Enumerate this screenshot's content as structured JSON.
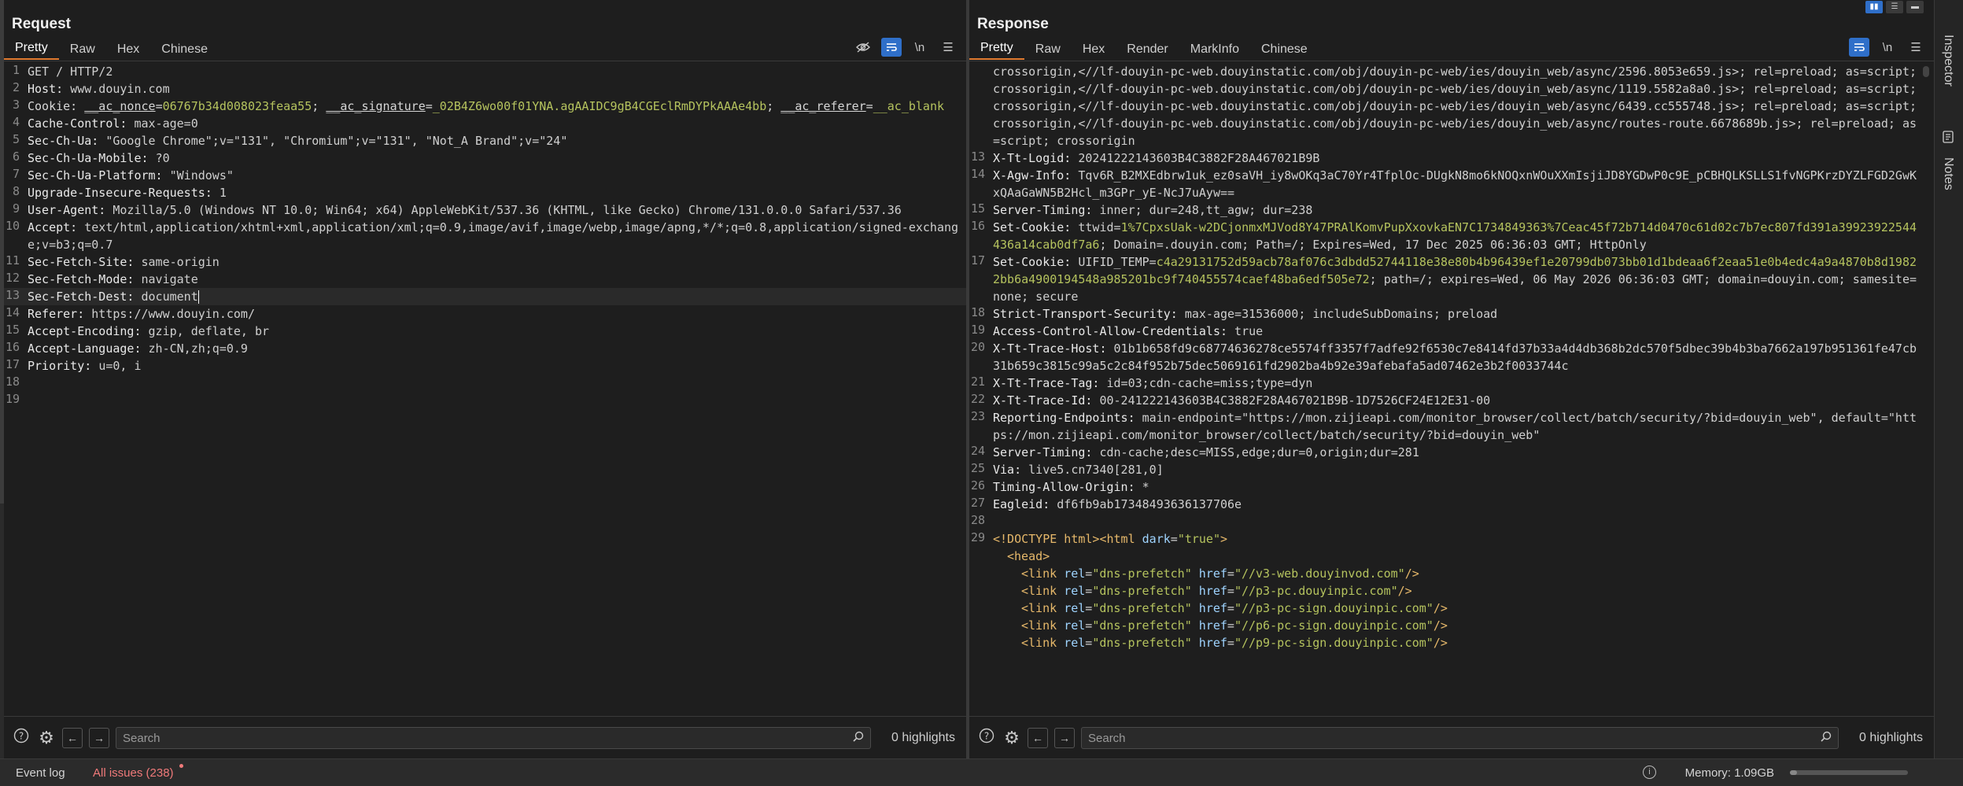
{
  "request": {
    "title": "Request",
    "tabs": [
      "Pretty",
      "Raw",
      "Hex",
      "Chinese"
    ],
    "active_tab": "Pretty",
    "lines": [
      {
        "n": "1",
        "plain": "GET / HTTP/2"
      },
      {
        "n": "2",
        "k": "Host: ",
        "v": "www.douyin.com"
      },
      {
        "n": "3",
        "cookie": [
          {
            "t": "Cookie: ",
            "c": "ck"
          },
          {
            "t": "__ac_nonce",
            "c": "cu"
          },
          {
            "t": "=",
            "c": "ck"
          },
          {
            "t": "06767b34d008023feaa55",
            "c": "cv"
          },
          {
            "t": "; ",
            "c": "ck"
          },
          {
            "t": "__ac_signature",
            "c": "cu"
          },
          {
            "t": "=",
            "c": "ck"
          },
          {
            "t": "_02B4Z6wo00f01YNA.agAAIDC9gB4CGEclRmDYPkAAAe4bb",
            "c": "cv"
          },
          {
            "t": "; ",
            "c": "ck"
          },
          {
            "t": "__ac_referer",
            "c": "cu"
          },
          {
            "t": "=",
            "c": "ck"
          },
          {
            "t": "__ac_blank",
            "c": "cv"
          }
        ]
      },
      {
        "n": "4",
        "k": "Cache-Control: ",
        "v": "max-age=0"
      },
      {
        "n": "5",
        "k": "Sec-Ch-Ua: ",
        "v": "\"Google Chrome\";v=\"131\", \"Chromium\";v=\"131\", \"Not_A Brand\";v=\"24\""
      },
      {
        "n": "6",
        "k": "Sec-Ch-Ua-Mobile: ",
        "v": "?0"
      },
      {
        "n": "7",
        "k": "Sec-Ch-Ua-Platform: ",
        "v": "\"Windows\""
      },
      {
        "n": "8",
        "k": "Upgrade-Insecure-Requests: ",
        "v": "1"
      },
      {
        "n": "9",
        "k": "User-Agent: ",
        "v": "Mozilla/5.0 (Windows NT 10.0; Win64; x64) AppleWebKit/537.36 (KHTML, like Gecko) Chrome/131.0.0.0 Safari/537.36"
      },
      {
        "n": "10",
        "k": "Accept: ",
        "v": "text/html,application/xhtml+xml,application/xml;q=0.9,image/avif,image/webp,image/apng,*/*;q=0.8,application/signed-exchange;v=b3;q=0.7",
        "wrap": true
      },
      {
        "n": "11",
        "k": "Sec-Fetch-Site: ",
        "v": "same-origin"
      },
      {
        "n": "12",
        "k": "Sec-Fetch-Mode: ",
        "v": "navigate"
      },
      {
        "n": "13",
        "k": "Sec-Fetch-Dest: ",
        "v": "document",
        "caret": true
      },
      {
        "n": "14",
        "k": "Referer: ",
        "v": "https://www.douyin.com/"
      },
      {
        "n": "15",
        "k": "Accept-Encoding: ",
        "v": "gzip, deflate, br"
      },
      {
        "n": "16",
        "k": "Accept-Language: ",
        "v": "zh-CN,zh;q=0.9"
      },
      {
        "n": "17",
        "k": "Priority: ",
        "v": "u=0, i"
      },
      {
        "n": "18",
        "plain": ""
      },
      {
        "n": "19",
        "plain": ""
      }
    ],
    "search_placeholder": "Search",
    "highlights": "0 highlights"
  },
  "response": {
    "title": "Response",
    "tabs": [
      "Pretty",
      "Raw",
      "Hex",
      "Render",
      "MarkInfo",
      "Chinese"
    ],
    "active_tab": "Pretty",
    "lines": [
      {
        "n": "",
        "plain": "crossorigin,<//lf-douyin-pc-web.douyinstatic.com/obj/douyin-pc-web/ies/douyin_web/async/2596.8053e659.js>; rel=preload; as=script; crossorigin,<//lf-douyin-pc-web.douyinstatic.com/obj/douyin-pc-web/ies/douyin_web/async/1119.5582a8a0.js>; rel=preload; as=script; crossorigin,<//lf-douyin-pc-web.douyinstatic.com/obj/douyin-pc-web/ies/douyin_web/async/6439.cc555748.js>; rel=preload; as=script; crossorigin,<//lf-douyin-pc-web.douyinstatic.com/obj/douyin-pc-web/ies/douyin_web/async/routes-route.6678689b.js>; rel=preload; as=script; crossorigin"
      },
      {
        "n": "13",
        "k": "X-Tt-Logid: ",
        "v": "20241222143603B4C3882F28A467021B9B"
      },
      {
        "n": "14",
        "k": "X-Agw-Info: ",
        "v": "Tqv6R_B2MXEdbrw1uk_ez0saVH_iy8wOKq3aC70Yr4TfplOc-DUgkN8mo6kNOQxnWOuXXmIsjiJD8YGDwP0c9E_pCBHQLKSLLS1fvNGPKrzDYZLFGD2GwKxQAaGaWN5B2Hcl_m3GPr_yE-NcJ7uAyw==",
        "wrap": true
      },
      {
        "n": "15",
        "k": "Server-Timing: ",
        "v": "inner; dur=248,tt_agw; dur=238"
      },
      {
        "n": "16",
        "k": "Set-Cookie: ",
        "v": "ttwid=",
        "v2": "1%7CpxsUak-w2DCjonmxMJVod8Y47PRAlKomvPupXxovkaEN7C1734849363%7Ceac45f72b714d0470c61d02c7b7ec807fd391a39923922544436a14cab0df7a6",
        "v3": "; Domain=.douyin.com; Path=/; Expires=Wed, 17 Dec 2025 06:36:03 GMT; HttpOnly",
        "wrap": true
      },
      {
        "n": "17",
        "k": "Set-Cookie: ",
        "v": "UIFID_TEMP=",
        "v2": "c4a29131752d59acb78af076c3dbdd52744118e38e80b4b96439ef1e20799db073bb01d1bdeaa6f2eaa51e0b4edc4a9a4870b8d19822bb6a4900194548a985201bc9f740455574caef48ba6edf505e72",
        "v3": "; path=/; expires=Wed, 06 May 2026 06:36:03 GMT; domain=douyin.com; samesite=none; secure",
        "wrap": true
      },
      {
        "n": "18",
        "k": "Strict-Transport-Security: ",
        "v": "max-age=31536000; includeSubDomains; preload"
      },
      {
        "n": "19",
        "k": "Access-Control-Allow-Credentials: ",
        "v": "true"
      },
      {
        "n": "20",
        "k": "X-Tt-Trace-Host: ",
        "v": "01b1b658fd9c68774636278ce5574ff3357f7adfe92f6530c7e8414fd37b33a4d4db368b2dc570f5dbec39b4b3ba7662a197b951361fe47cb31b659c3815c99a5c2c84f952b75dec5069161fd2902ba4b92e39afebafa5ad07462e3b2f0033744c",
        "wrap": true
      },
      {
        "n": "21",
        "k": "X-Tt-Trace-Tag: ",
        "v": "id=03;cdn-cache=miss;type=dyn"
      },
      {
        "n": "22",
        "k": "X-Tt-Trace-Id: ",
        "v": "00-241222143603B4C3882F28A467021B9B-1D7526CF24E12E31-00"
      },
      {
        "n": "23",
        "k": "Reporting-Endpoints: ",
        "v": "main-endpoint=\"https://mon.zijieapi.com/monitor_browser/collect/batch/security/?bid=douyin_web\", default=\"https://mon.zijieapi.com/monitor_browser/collect/batch/security/?bid=douyin_web\""
      },
      {
        "n": "24",
        "k": "Server-Timing: ",
        "v": "cdn-cache;desc=MISS,edge;dur=0,origin;dur=281"
      },
      {
        "n": "25",
        "k": "Via: ",
        "v": "live5.cn7340[281,0]"
      },
      {
        "n": "26",
        "k": "Timing-Allow-Origin: ",
        "v": "*"
      },
      {
        "n": "27",
        "k": "Eagleid: ",
        "v": "df6fb9ab17348493636137706e"
      },
      {
        "n": "28",
        "plain": ""
      },
      {
        "n": "29",
        "html": [
          {
            "t": "<!DOCTYPE html>",
            "c": "tag"
          },
          {
            "t": "<html ",
            "c": "tag"
          },
          {
            "t": "dark",
            "c": "an"
          },
          {
            "t": "=",
            "c": "hv"
          },
          {
            "t": "\"true\"",
            "c": "av"
          },
          {
            "t": ">",
            "c": "tag"
          }
        ]
      },
      {
        "n": "",
        "indent": 1,
        "html": [
          {
            "t": "<head>",
            "c": "tag"
          }
        ]
      },
      {
        "n": "",
        "indent": 2,
        "html": [
          {
            "t": "<link ",
            "c": "tag"
          },
          {
            "t": "rel",
            "c": "an"
          },
          {
            "t": "=",
            "c": "hv"
          },
          {
            "t": "\"dns-prefetch\"",
            "c": "av"
          },
          {
            "t": " href",
            "c": "an"
          },
          {
            "t": "=",
            "c": "hv"
          },
          {
            "t": "\"//v3-web.douyinvod.com\"",
            "c": "av"
          },
          {
            "t": "/>",
            "c": "tag"
          }
        ]
      },
      {
        "n": "",
        "indent": 2,
        "html": [
          {
            "t": "<link ",
            "c": "tag"
          },
          {
            "t": "rel",
            "c": "an"
          },
          {
            "t": "=",
            "c": "hv"
          },
          {
            "t": "\"dns-prefetch\"",
            "c": "av"
          },
          {
            "t": " href",
            "c": "an"
          },
          {
            "t": "=",
            "c": "hv"
          },
          {
            "t": "\"//p3-pc.douyinpic.com\"",
            "c": "av"
          },
          {
            "t": "/>",
            "c": "tag"
          }
        ]
      },
      {
        "n": "",
        "indent": 2,
        "html": [
          {
            "t": "<link ",
            "c": "tag"
          },
          {
            "t": "rel",
            "c": "an"
          },
          {
            "t": "=",
            "c": "hv"
          },
          {
            "t": "\"dns-prefetch\"",
            "c": "av"
          },
          {
            "t": " href",
            "c": "an"
          },
          {
            "t": "=",
            "c": "hv"
          },
          {
            "t": "\"//p3-pc-sign.douyinpic.com\"",
            "c": "av"
          },
          {
            "t": "/>",
            "c": "tag"
          }
        ]
      },
      {
        "n": "",
        "indent": 2,
        "html": [
          {
            "t": "<link ",
            "c": "tag"
          },
          {
            "t": "rel",
            "c": "an"
          },
          {
            "t": "=",
            "c": "hv"
          },
          {
            "t": "\"dns-prefetch\"",
            "c": "av"
          },
          {
            "t": " href",
            "c": "an"
          },
          {
            "t": "=",
            "c": "hv"
          },
          {
            "t": "\"//p6-pc-sign.douyinpic.com\"",
            "c": "av"
          },
          {
            "t": "/>",
            "c": "tag"
          }
        ]
      },
      {
        "n": "",
        "indent": 2,
        "html": [
          {
            "t": "<link ",
            "c": "tag"
          },
          {
            "t": "rel",
            "c": "an"
          },
          {
            "t": "=",
            "c": "hv"
          },
          {
            "t": "\"dns-prefetch\"",
            "c": "av"
          },
          {
            "t": " href",
            "c": "an"
          },
          {
            "t": "=",
            "c": "hv"
          },
          {
            "t": "\"//p9-pc-sign.douyinpic.com\"",
            "c": "av"
          },
          {
            "t": "/>",
            "c": "tag"
          }
        ]
      }
    ],
    "search_placeholder": "Search",
    "highlights": "0 highlights"
  },
  "sidebar": {
    "inspector": "Inspector",
    "notes": "Notes"
  },
  "status": {
    "event_log": "Event log",
    "issues": "All issues (238)",
    "memory": "Memory: 1.09GB",
    "memory_fraction": 0.06
  },
  "colors": {
    "accent": "#e07a2f",
    "toggle_on": "#2f6fc9",
    "issues": "#f07a7a"
  }
}
